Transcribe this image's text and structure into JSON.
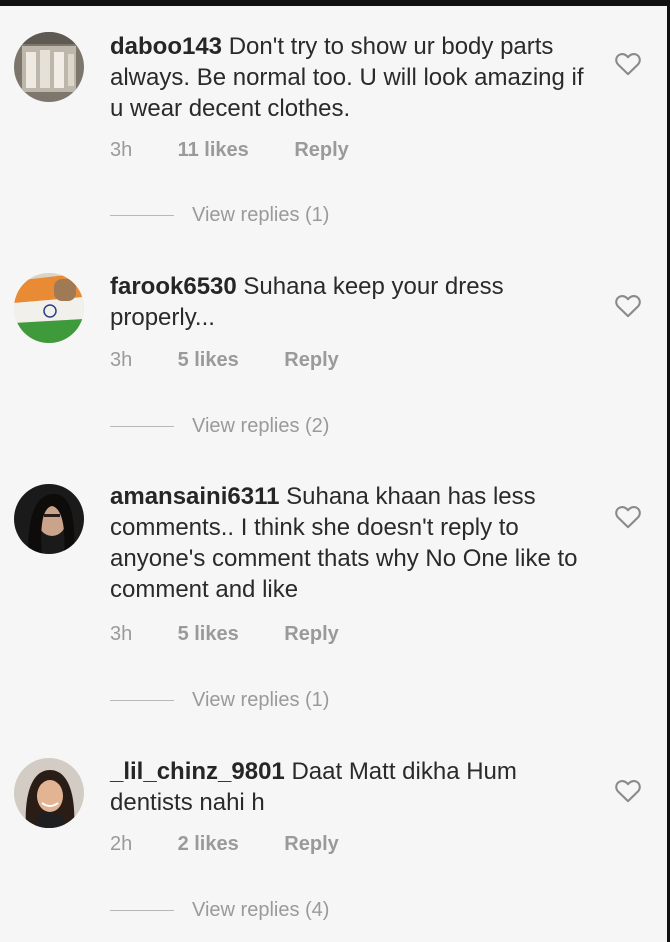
{
  "comments": [
    {
      "username": "daboo143",
      "text": "Don't try to show ur body parts always. Be normal too. U will look amazing if u wear decent clothes.",
      "time": "3h",
      "likes": "11 likes",
      "reply": "Reply",
      "view_replies": "View replies (1)",
      "icon": "heart-outline-icon"
    },
    {
      "username": "farook6530",
      "text": "Suhana keep your dress properly...",
      "time": "3h",
      "likes": "5 likes",
      "reply": "Reply",
      "view_replies": "View replies (2)",
      "icon": "heart-outline-icon"
    },
    {
      "username": "amansaini6311",
      "text": "Suhana khaan has less comments.. I think she doesn't reply to anyone's comment thats why No One like to comment and like",
      "time": "3h",
      "likes": "5 likes",
      "reply": "Reply",
      "view_replies": "View replies (1)",
      "icon": "heart-outline-icon"
    },
    {
      "username": "_lil_chinz_9801",
      "text": "Daat Matt dikha Hum dentists nahi h",
      "time": "2h",
      "likes": "2 likes",
      "reply": "Reply",
      "view_replies": "View replies (4)",
      "icon": "heart-outline-icon"
    }
  ],
  "colors": {
    "background": "#f6f6f6",
    "text": "#262626",
    "secondary": "#9a9a9a"
  }
}
